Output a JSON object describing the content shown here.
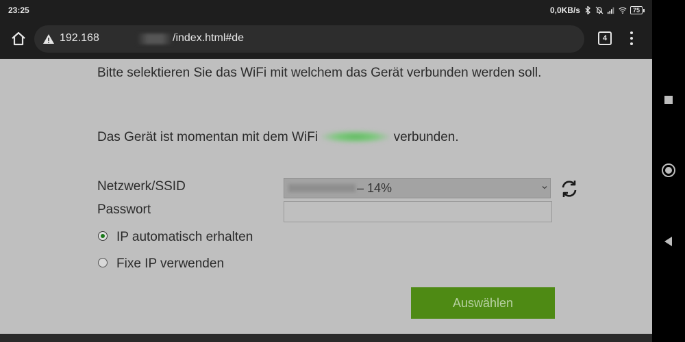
{
  "status_bar": {
    "time": "23:25",
    "network_speed": "0,0KB/s",
    "battery": "75",
    "icons": [
      "bluetooth-icon",
      "mute-bell-icon",
      "signal-icon",
      "wifi-icon",
      "battery-icon"
    ]
  },
  "browser": {
    "url_prefix": "192.168",
    "url_suffix": "/index.html#de",
    "tab_count": "4",
    "icons": [
      "home-icon",
      "warning-icon",
      "tabs-icon",
      "more-menu-icon"
    ]
  },
  "page": {
    "intro": "Bitte selektieren Sie das WiFi mit welchem das Gerät verbunden werden soll.",
    "connected_prefix": "Das Gerät ist momentan mit dem WiFi ",
    "connected_suffix": " verbunden.",
    "ssid_label": "Netzwerk/SSID",
    "ssid_value_suffix": "– 14%",
    "password_label": "Passwort",
    "password_value": "",
    "radio_auto_label": "IP automatisch erhalten",
    "radio_fixed_label": "Fixe IP verwenden",
    "radio_selected": "auto",
    "submit_label": "Auswählen"
  },
  "colors": {
    "page_background": "#bfbfbf",
    "button_green": "#4e8a14",
    "radio_selected": "#1a7a1a"
  }
}
